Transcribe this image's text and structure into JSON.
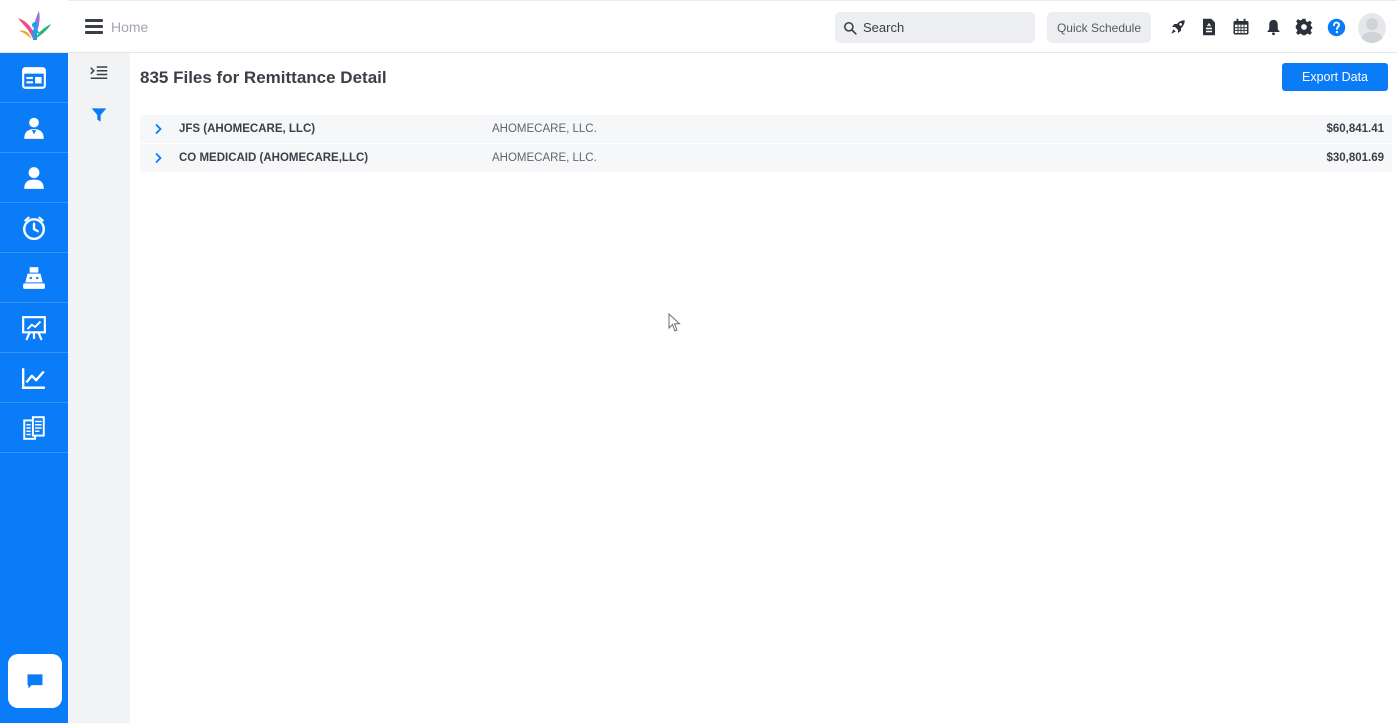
{
  "header": {
    "breadcrumb_home": "Home",
    "search_placeholder": "Search",
    "quick_schedule_label": "Quick Schedule",
    "icons": [
      "rocket-icon",
      "document-icon",
      "calendar-icon",
      "bell-icon",
      "gear-icon",
      "help-icon"
    ]
  },
  "sidebar": {
    "items": [
      {
        "icon": "dashboard-icon"
      },
      {
        "icon": "caregiver-icon"
      },
      {
        "icon": "client-icon"
      },
      {
        "icon": "clock-icon"
      },
      {
        "icon": "billing-icon"
      },
      {
        "icon": "presentation-icon"
      },
      {
        "icon": "analytics-icon"
      },
      {
        "icon": "reports-icon"
      }
    ],
    "chat_icon": "chat-icon"
  },
  "page": {
    "title": "835 Files for Remittance Detail",
    "export_label": "Export Data"
  },
  "remittances": [
    {
      "payer": "JFS (AHOMECARE, LLC)",
      "organization": "AHOMECARE, LLC.",
      "amount": "$60,841.41"
    },
    {
      "payer": "CO MEDICAID (AHOMECARE,LLC)",
      "organization": "AHOMECARE, LLC.",
      "amount": "$30,801.69"
    }
  ],
  "colors": {
    "primary": "#0a7cf7",
    "rail_bg": "#0a7cf7",
    "subrail_bg": "#f2f3f5",
    "row_bg": "#f6f7f9",
    "title_text": "#3b4048"
  }
}
